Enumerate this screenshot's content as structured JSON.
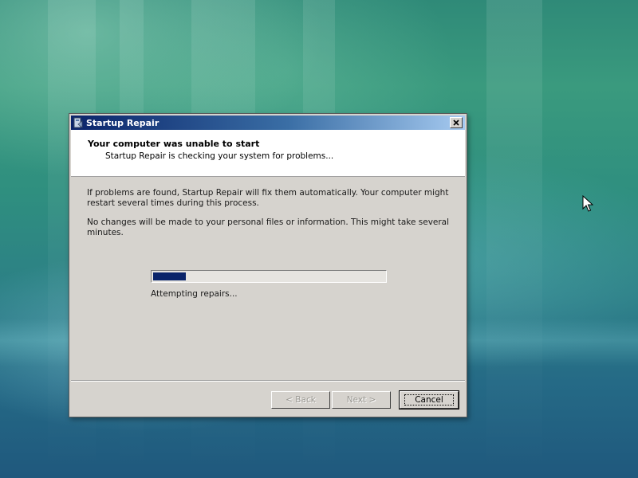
{
  "window": {
    "title": "Startup Repair",
    "close_glyph": "✕"
  },
  "header": {
    "title": "Your computer was unable to start",
    "subtitle": "Startup Repair is checking your system for problems..."
  },
  "body": {
    "paragraph1": "If problems are found, Startup Repair will fix them automatically. Your computer might restart several times during this process.",
    "paragraph2": "No changes will be made to your personal files or information. This might take several minutes."
  },
  "progress": {
    "label": "Attempting repairs...",
    "fraction": 0.14
  },
  "buttons": {
    "back": "< Back",
    "next": "Next >",
    "cancel": "Cancel"
  },
  "colors": {
    "title_bar_start": "#0a246a",
    "title_bar_end": "#a6caf0",
    "progress_fill": "#0a246a",
    "dialog_face": "#d6d3ce"
  },
  "icons": {
    "title": "startup-repair-icon",
    "close": "close-icon",
    "pointer": "mouse-pointer-icon"
  }
}
